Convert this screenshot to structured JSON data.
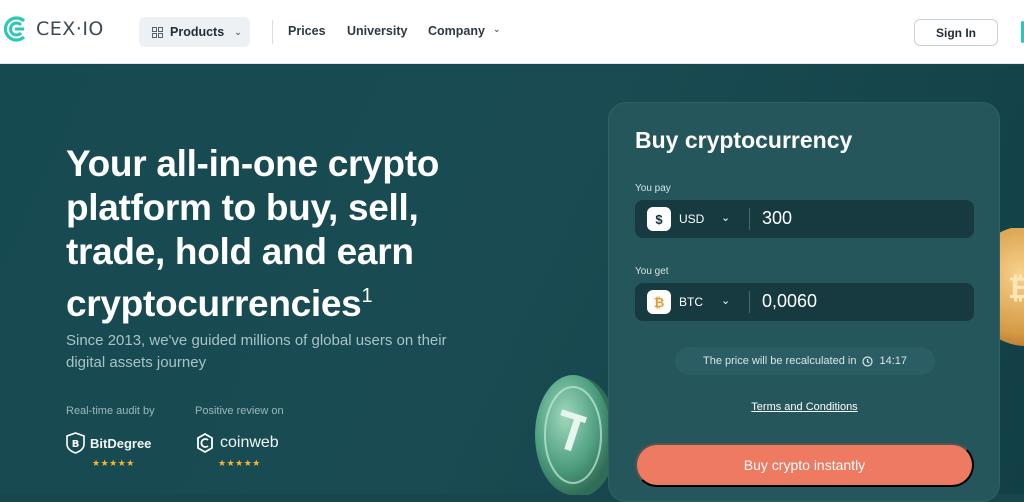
{
  "nav": {
    "logo_text": "CEX·IO",
    "products_label": "Products",
    "links": [
      "Prices",
      "University",
      "Company"
    ],
    "signin_label": "Sign In"
  },
  "hero": {
    "headline": "Your all-in-one crypto platform to buy, sell, trade, hold and earn cryptocurrencies",
    "headline_footnote": "1",
    "subtitle": "Since 2013, we've guided millions of global users on their digital assets journey",
    "audit_label": "Real-time audit by",
    "audit_brand": "BitDegree",
    "review_label": "Positive review on",
    "review_brand": "coinweb",
    "stars": "★★★★★"
  },
  "widget": {
    "title": "Buy cryptocurrency",
    "pay_label": "You pay",
    "pay_symbol": "$",
    "pay_currency": "USD",
    "pay_amount": "300",
    "get_label": "You get",
    "get_symbol": "₿",
    "get_currency": "BTC",
    "get_amount": "0,0060",
    "recalc_text": "The price will be recalculated in",
    "recalc_time": "14:17",
    "terms_label": "Terms and Conditions",
    "cta_label": "Buy crypto instantly"
  },
  "icons": [
    "grid-icon",
    "chevron-down-icon",
    "clock-icon",
    "bitdegree-shield-icon",
    "coinweb-logo-icon"
  ],
  "colors": {
    "hero_bg": "#17464d",
    "card_bg": "#24565c",
    "cta": "#ee7a62",
    "accent": "#2ec6b6",
    "stars": "#f4b63a"
  }
}
